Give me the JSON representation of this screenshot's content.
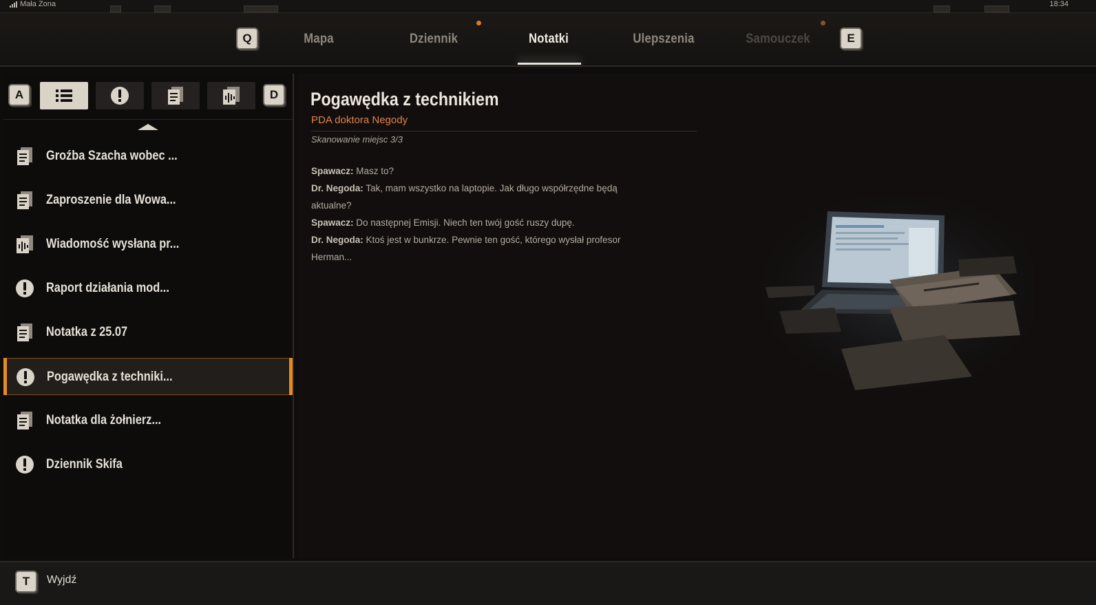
{
  "status": {
    "carrier": "Mała Zona",
    "time": "18:34"
  },
  "nav": {
    "prev_key": "Q",
    "next_key": "E",
    "tabs": [
      {
        "label": "Mapa",
        "state": "normal",
        "dot": false
      },
      {
        "label": "Dziennik",
        "state": "normal",
        "dot": true
      },
      {
        "label": "Notatki",
        "state": "active",
        "dot": false
      },
      {
        "label": "Ulepszenia",
        "state": "normal",
        "dot": false
      },
      {
        "label": "Samouczek",
        "state": "disabled",
        "dot": true
      }
    ],
    "accent": "#d47c2a"
  },
  "filters": {
    "prev_key": "A",
    "next_key": "D",
    "buttons": [
      {
        "icon": "list-icon",
        "active": true
      },
      {
        "icon": "exclamation-icon",
        "active": false
      },
      {
        "icon": "document-icon",
        "active": false
      },
      {
        "icon": "audio-note-icon",
        "active": false
      }
    ]
  },
  "notes": [
    {
      "label": "Groźba Szacha wobec ...",
      "icon": "document-icon",
      "selected": false
    },
    {
      "label": "Zaproszenie dla Wowa...",
      "icon": "document-icon",
      "selected": false
    },
    {
      "label": "Wiadomość wysłana pr...",
      "icon": "audio-note-icon",
      "selected": false
    },
    {
      "label": "Raport działania mod...",
      "icon": "exclamation-icon",
      "selected": false
    },
    {
      "label": "Notatka z 25.07",
      "icon": "document-icon",
      "selected": false
    },
    {
      "label": "Pogawędka z techniki...",
      "icon": "exclamation-icon",
      "selected": true
    },
    {
      "label": "Notatka dla żołnierz...",
      "icon": "document-icon",
      "selected": false
    },
    {
      "label": "Dziennik Skifa",
      "icon": "exclamation-icon",
      "selected": false
    }
  ],
  "detail": {
    "title": "Pogawędka z technikiem",
    "source": "PDA doktora Negody",
    "meta": "Skanowanie miejsc 3/3",
    "lines": [
      {
        "speaker": "Spawacz:",
        "text": " Masz to?"
      },
      {
        "speaker": "Dr. Negoda:",
        "text": " Tak, mam wszystko na laptopie. Jak długo współrzędne będą aktualne?"
      },
      {
        "speaker": "Spawacz:",
        "text": " Do następnej Emisji. Niech ten twój gość ruszy dupę."
      },
      {
        "speaker": "Dr. Negoda:",
        "text": " Ktoś jest w bunkrze. Pewnie ten gość, którego wysłał profesor Herman..."
      }
    ],
    "selection_color": "#e58b24",
    "source_color": "#e3834a"
  },
  "footer": {
    "exit_key": "T",
    "exit_label": "Wyjdź"
  }
}
